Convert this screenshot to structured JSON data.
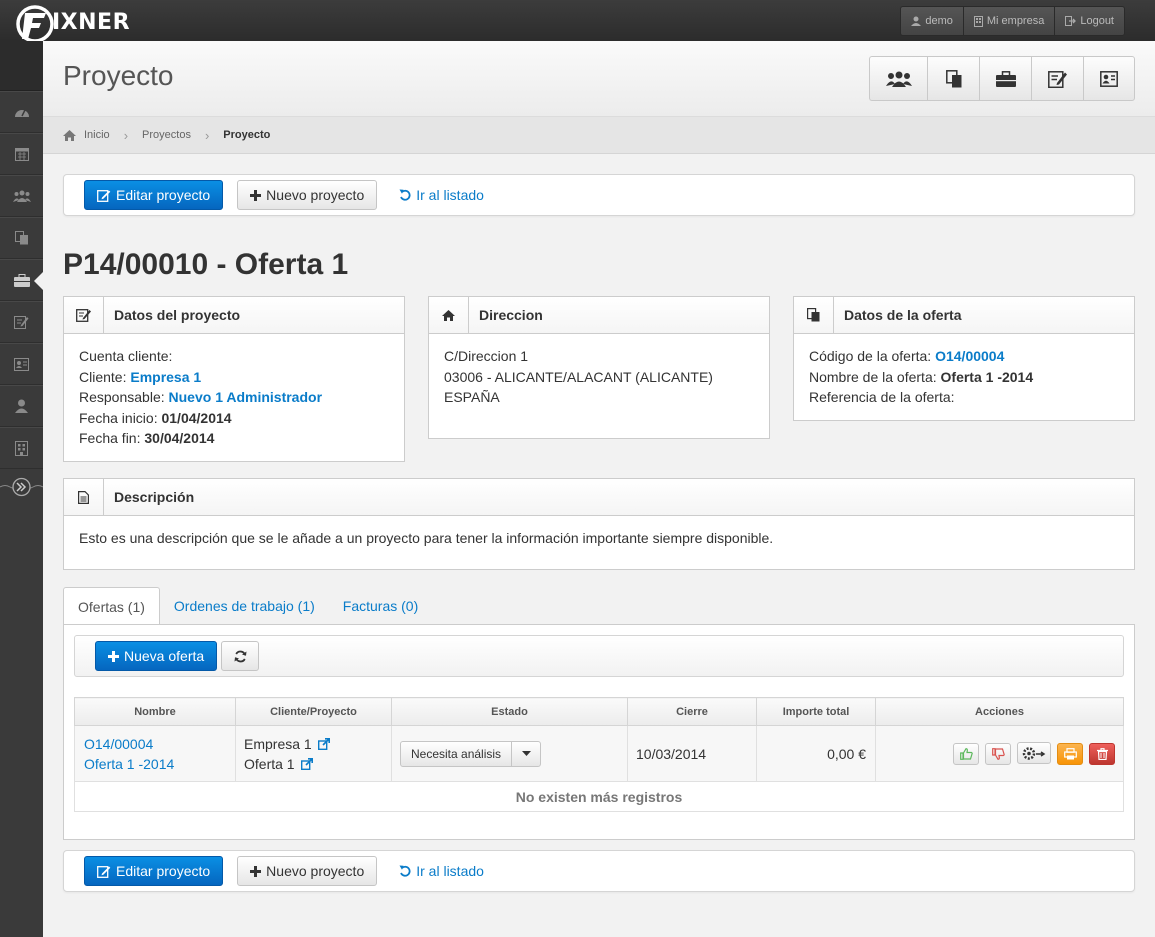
{
  "app": {
    "logo_text": "IXNER"
  },
  "topbar": {
    "user_label": "demo",
    "company_label": "Mi empresa",
    "logout_label": "Logout"
  },
  "sidebar": {
    "items": [
      {
        "icon": "dashboard-icon"
      },
      {
        "icon": "calendar-icon"
      },
      {
        "icon": "users-icon"
      },
      {
        "icon": "copy-documents-icon"
      },
      {
        "icon": "briefcase-icon",
        "active": true
      },
      {
        "icon": "edit-icon"
      },
      {
        "icon": "contact-card-icon"
      },
      {
        "icon": "user-icon"
      },
      {
        "icon": "building-icon"
      }
    ]
  },
  "header": {
    "title": "Proyecto",
    "buttons": [
      "users-icon",
      "copy-documents-icon",
      "briefcase-icon",
      "edit-icon",
      "contact-card-icon"
    ]
  },
  "breadcrumb": {
    "home": "Inicio",
    "parent": "Proyectos",
    "current": "Proyecto"
  },
  "toolbar": {
    "edit_label": "Editar proyecto",
    "new_label": "Nuevo proyecto",
    "list_label": "Ir al listado"
  },
  "project": {
    "title": "P14/00010 - Oferta 1"
  },
  "datos_proyecto": {
    "title": "Datos del proyecto",
    "cuenta_label": "Cuenta cliente:",
    "cliente_label": "Cliente:",
    "cliente_value": "Empresa 1",
    "responsable_label": "Responsable:",
    "responsable_value": "Nuevo 1 Administrador",
    "inicio_label": "Fecha inicio:",
    "inicio_value": "01/04/2014",
    "fin_label": "Fecha fin:",
    "fin_value": "30/04/2014"
  },
  "direccion": {
    "title": "Direccion",
    "line1": "C/Direccion 1",
    "line2": "03006 - ALICANTE/ALACANT (ALICANTE)",
    "line3": "ESPAÑA"
  },
  "datos_oferta": {
    "title": "Datos de la oferta",
    "codigo_label": "Código de la oferta:",
    "codigo_value": "O14/00004",
    "nombre_label": "Nombre de la oferta:",
    "nombre_value": "Oferta 1 -2014",
    "referencia_label": "Referencia de la oferta:"
  },
  "descripcion": {
    "title": "Descripción",
    "text": "Esto es una descripción que se le añade a un proyecto para tener la información importante siempre disponible."
  },
  "tabs": [
    "Ofertas (1)",
    "Ordenes de trabajo (1)",
    "Facturas (0)"
  ],
  "ofertas": {
    "new_label": "Nueva oferta",
    "columns": [
      "Nombre",
      "Cliente/Proyecto",
      "Estado",
      "Cierre",
      "Importe total",
      "Acciones"
    ],
    "row": {
      "codigo": "O14/00004",
      "nombre": "Oferta 1 -2014",
      "cliente": "Empresa 1",
      "proyecto": "Oferta 1",
      "estado": "Necesita análisis",
      "cierre": "10/03/2014",
      "importe": "0,00 €"
    },
    "empty_text": "No existen más registros"
  },
  "colors": {
    "primary": "#0566bf",
    "link": "#0a7cc9",
    "approve": "#5cb85c",
    "reject": "#d9534f",
    "print": "#f89406",
    "delete": "#bd362f"
  }
}
